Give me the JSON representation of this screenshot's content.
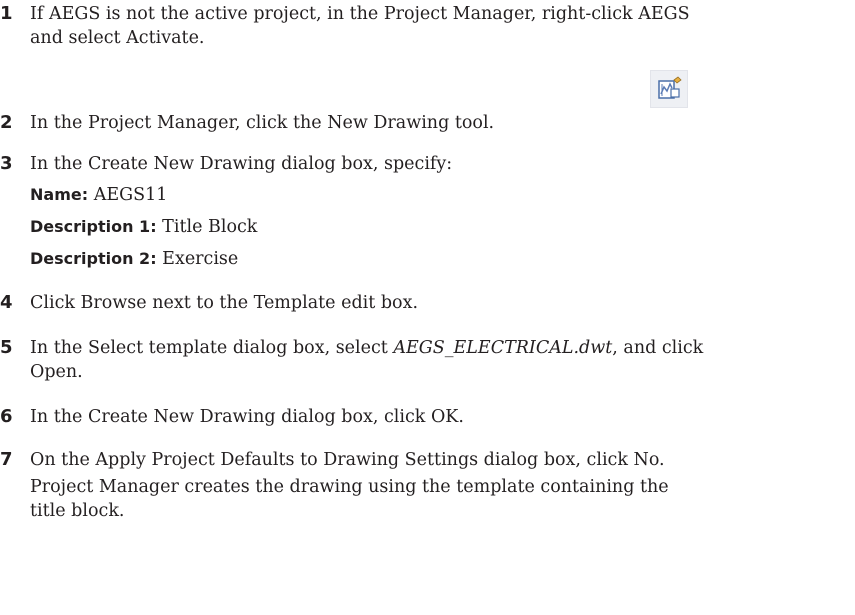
{
  "steps": [
    {
      "number": "1",
      "lines": [
        "If AEGS is not the active project, in the Project Manager, right-click AEGS",
        "and select Activate."
      ]
    },
    {
      "number": "2",
      "text": "In the Project Manager, click the New Drawing tool.",
      "icon": "new-drawing-tool-icon"
    },
    {
      "number": "3",
      "text": "In the Create New Drawing dialog box, specify:",
      "fields": [
        {
          "label": "Name:",
          "value": "AEGS11"
        },
        {
          "label": "Description 1:",
          "value": "Title Block"
        },
        {
          "label": "Description 2:",
          "value": "Exercise"
        }
      ]
    },
    {
      "number": "4",
      "text": "Click Browse next to the Template edit box."
    },
    {
      "number": "5",
      "line1_before": "In the Select template dialog box, select ",
      "line1_italic": "AEGS_ELECTRICAL.dwt",
      "line1_after": ", and click",
      "line2": "Open."
    },
    {
      "number": "6",
      "text": "In the Create New Drawing dialog box, click OK."
    },
    {
      "number": "7",
      "text": "On the Apply Project Defaults to Drawing Settings dialog box, click No.",
      "note_lines": [
        "Project Manager creates the drawing using the template containing the",
        "title block."
      ]
    }
  ]
}
